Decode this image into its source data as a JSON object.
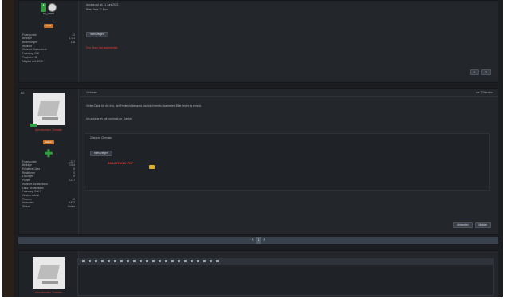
{
  "post1": {
    "username": "aa_name",
    "role": "Held",
    "stats": [
      {
        "label": "Forenpunkte",
        "value": "42"
      },
      {
        "label": "Beiträge",
        "value": "1.111"
      },
      {
        "label": "Bewertungen",
        "value": "138"
      },
      {
        "label": "Wohnort",
        "value": ""
      }
    ],
    "extra": [
      "Wohnort: Somewhere",
      "Fahrzeug: Golf",
      "Trophäen: 11",
      "Mitglied seit: 2019"
    ],
    "line1": "Ausbau ist ab 11 Juni 2021",
    "line2": "Bitte Preis 11 Euro",
    "more_button": "mehr zeigen",
    "red_note": "Das Team hat das erledigt",
    "action_buttons": [
      "↩",
      "✎"
    ]
  },
  "post2": {
    "post_number": "#2",
    "author_label": "Verfasser",
    "timestamp": "vor 7 Stunden",
    "username": "Administrator Christian",
    "role": "Admin",
    "stats": [
      {
        "label": "Forenpunkte",
        "value": "1.327"
      },
      {
        "label": "Beiträge",
        "value": "2.054"
      },
      {
        "label": "Erhaltene Likes",
        "value": "6"
      },
      {
        "label": "Reaktionen",
        "value": "0"
      },
      {
        "label": "Lösungen",
        "value": "0"
      },
      {
        "label": "Punkte",
        "value": "2.217"
      }
    ],
    "info": [
      "Wohnort: Deutschland",
      "Land: Deutschland",
      "Fahrzeug: Golf 7",
      "Version: Admin"
    ],
    "info2": [
      {
        "label": "Themen",
        "value": "40"
      },
      {
        "label": "Antworten",
        "value": "9.872"
      },
      {
        "label": "Status",
        "value": "Online"
      }
    ],
    "body_line1": "Vielen Dank für die Info, der Fehler ist bekannt und wird bereits bearbeitet. Bitte testet es erneut.",
    "body_line2": "Ich schaue es mir nochmal an, Danke.",
    "quote_line": "Zitat von Christian",
    "quote_button": "mehr zeigen",
    "red_link": "ANLEITUNG PDF",
    "reply_button": "Antworten",
    "report_button": "Melden"
  },
  "pagination": {
    "prev": "‹",
    "current": "1",
    "next": "›"
  },
  "post3": {
    "username": "Administrator Christian"
  },
  "toolbar_icons": [
    "bold-icon",
    "italic-icon",
    "underline-icon",
    "strike-icon",
    "font-icon",
    "size-icon",
    "color-icon",
    "align-left-icon",
    "align-center-icon",
    "align-right-icon",
    "list-icon",
    "list-ordered-icon",
    "link-icon",
    "image-icon",
    "media-icon",
    "code-icon",
    "quote-icon",
    "table-icon",
    "smiley-icon",
    "undo-icon",
    "redo-icon",
    "preview-icon"
  ],
  "colors": {
    "accent_green": "#2e9e3f",
    "accent_orange": "#c8742a",
    "red_text": "#d9413a",
    "nav_bg": "#39414d"
  }
}
